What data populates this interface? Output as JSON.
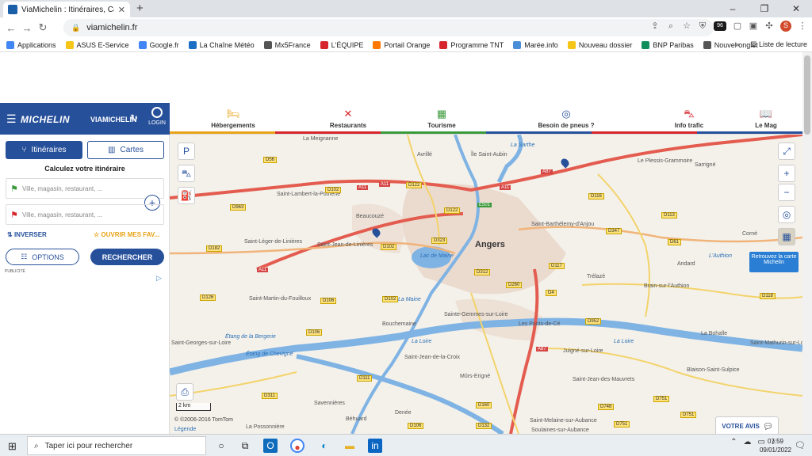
{
  "browser": {
    "tab_title": "ViaMichelin : Itinéraires, Cartes, It",
    "url": "viamichelin.fr",
    "profile_initial": "S",
    "ext_badge": "96",
    "window_controls": [
      "–",
      "❐",
      "✕"
    ]
  },
  "bookmarks": [
    {
      "label": "Applications",
      "color": "#4285f4"
    },
    {
      "label": "ASUS E-Service",
      "color": "#f5c518"
    },
    {
      "label": "Google.fr",
      "color": "#4285f4"
    },
    {
      "label": "La Chaîne Météo",
      "color": "#1a6fc4"
    },
    {
      "label": "Mx5France",
      "color": "#555555"
    },
    {
      "label": "L'ÉQUIPE",
      "color": "#d6252c"
    },
    {
      "label": "Portail Orange",
      "color": "#ff7900"
    },
    {
      "label": "Programme TNT",
      "color": "#d6252c"
    },
    {
      "label": "Marée.info",
      "color": "#4a8ed8"
    },
    {
      "label": "Nouveau dossier",
      "color": "#f5c518"
    },
    {
      "label": "BNP Paribas",
      "color": "#108f5c"
    },
    {
      "label": "Nouvel onglet",
      "color": "#555555"
    }
  ],
  "bookmarks_more": "»",
  "reading_list": "Liste de lecture",
  "header": {
    "logo": "MICHELIN",
    "brand": "VIAMICHELIN",
    "login": "LOGIN"
  },
  "categories": [
    {
      "label": "Hébergements",
      "color": "#e8a317",
      "icon": "bed-icon"
    },
    {
      "label": "Restaurants",
      "color": "#d6252c",
      "icon": "restaurant-icon"
    },
    {
      "label": "Tourisme",
      "color": "#3a9a3a",
      "icon": "tourism-icon"
    },
    {
      "label": "Besoin de pneus ?",
      "color": "#27509b",
      "icon": "tyre-icon"
    },
    {
      "label": "Info trafic",
      "color": "#d6252c",
      "icon": "traffic-icon"
    },
    {
      "label": "Le Mag",
      "color": "#27509b",
      "icon": "magazine-icon"
    }
  ],
  "sidebar": {
    "tab_itineraires": "Itinéraires",
    "tab_cartes": "Cartes",
    "heading": "Calculez votre itinéraire",
    "from_placeholder": "Ville, magasin, restaurant, ...",
    "to_placeholder": "Ville, magasin, restaurant, ...",
    "invert": "INVERSER",
    "favorites": "OUVRIR MES FAV...",
    "options": "OPTIONS",
    "search": "RECHERCHER",
    "publicite": "PUBLICITÉ"
  },
  "map": {
    "main_city": "Angers",
    "places": [
      "La Meignanne",
      "Avrillé",
      "Île Saint-Aubin",
      "Le Plessis-Grammoire",
      "Sarrigné",
      "Saint-Lambert-la-Potherie",
      "Beaucouzé",
      "Saint-Barthélemy-d'Anjou",
      "Corné",
      "Saint-Léger-de-Linières",
      "Saint-Jean-de-Linières",
      "Andard",
      "Trélazé",
      "Brain-sur-l'Authion",
      "Saint-Martin-du-Fouilloux",
      "Bouchemaine",
      "Sainte-Gemmes-sur-Loire",
      "Les Ponts-de-Cé",
      "La Bohalle",
      "Saint-Georges-sur-Loire",
      "Saint-Jean-de-la-Croix",
      "Juigné-sur-Loire",
      "Saint-Mathurin-sur-Loire",
      "Blaison-Saint-Sulpice",
      "Mûrs-Erigné",
      "Saint-Jean-des-Mauvrets",
      "Savennières",
      "Denée",
      "Béhuard",
      "Saint-Melaine-sur-Aubance",
      "La Possonnière",
      "Soulaines-sur-Aubance"
    ],
    "rivers": [
      "La Loire",
      "La Loire",
      "La Maine",
      "La Sarthe",
      "L'Authion",
      "Lac de Maine",
      "Étang de la Bergerie",
      "Étang de Chevigné"
    ],
    "roads_yellow": [
      "D56",
      "D122",
      "D963",
      "D102",
      "D323",
      "D122",
      "D116",
      "D113",
      "D347",
      "D61",
      "D182",
      "D102",
      "D312",
      "D260",
      "D117",
      "D4",
      "D126",
      "D106",
      "D102",
      "D106",
      "D952",
      "D118",
      "D961",
      "D111",
      "D751",
      "D311",
      "D160",
      "D748",
      "D132",
      "D751",
      "D106",
      "D751"
    ],
    "roads_red": [
      "A11",
      "A11",
      "A11",
      "A87",
      "A11",
      "E501",
      "A87"
    ],
    "retrouvez": "Retrouvez la carte Michelin",
    "scale": "2 km",
    "copyright": "© ©2006-2016 TomTom",
    "legend": "Légende",
    "avis": "VOTRE AVIS"
  },
  "taskbar": {
    "search_placeholder": "Taper ici pour rechercher",
    "time": "07:59",
    "date": "09/01/2022",
    "notif_count": "10"
  }
}
